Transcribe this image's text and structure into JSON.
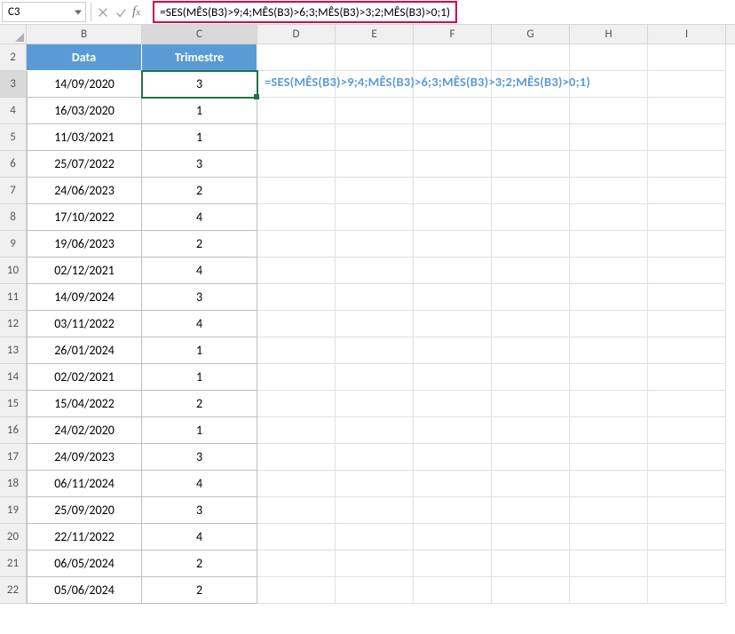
{
  "namebox": {
    "ref": "C3"
  },
  "formula_bar": {
    "formula": "=SES(MÊS(B3)>9;4;MÊS(B3)>6;3;MÊS(B3)>3;2;MÊS(B3)>0;1)"
  },
  "columns": [
    "B",
    "C",
    "D",
    "E",
    "F",
    "G",
    "H",
    "I"
  ],
  "active_cell": {
    "ref": "C3"
  },
  "table": {
    "headers": {
      "data": "Data",
      "trimestre": "Trimestre"
    },
    "rows": [
      {
        "r": 3,
        "data": "14/09/2020",
        "tri": "3"
      },
      {
        "r": 4,
        "data": "16/03/2020",
        "tri": "1"
      },
      {
        "r": 5,
        "data": "11/03/2021",
        "tri": "1"
      },
      {
        "r": 6,
        "data": "25/07/2022",
        "tri": "3"
      },
      {
        "r": 7,
        "data": "24/06/2023",
        "tri": "2"
      },
      {
        "r": 8,
        "data": "17/10/2022",
        "tri": "4"
      },
      {
        "r": 9,
        "data": "19/06/2023",
        "tri": "2"
      },
      {
        "r": 10,
        "data": "02/12/2021",
        "tri": "4"
      },
      {
        "r": 11,
        "data": "14/09/2024",
        "tri": "3"
      },
      {
        "r": 12,
        "data": "03/11/2022",
        "tri": "4"
      },
      {
        "r": 13,
        "data": "26/01/2024",
        "tri": "1"
      },
      {
        "r": 14,
        "data": "02/02/2021",
        "tri": "1"
      },
      {
        "r": 15,
        "data": "15/04/2022",
        "tri": "2"
      },
      {
        "r": 16,
        "data": "24/02/2020",
        "tri": "1"
      },
      {
        "r": 17,
        "data": "24/09/2023",
        "tri": "3"
      },
      {
        "r": 18,
        "data": "06/11/2024",
        "tri": "4"
      },
      {
        "r": 19,
        "data": "25/09/2020",
        "tri": "3"
      },
      {
        "r": 20,
        "data": "22/11/2022",
        "tri": "4"
      },
      {
        "r": 21,
        "data": "06/05/2024",
        "tri": "2"
      },
      {
        "r": 22,
        "data": "05/06/2024",
        "tri": "2"
      }
    ]
  },
  "formula_overlay": "=SES(MÊS(B3)>9;4;MÊS(B3)>6;3;MÊS(B3)>3;2;MÊS(B3)>0;1)",
  "row_start": 2,
  "row_end": 22
}
